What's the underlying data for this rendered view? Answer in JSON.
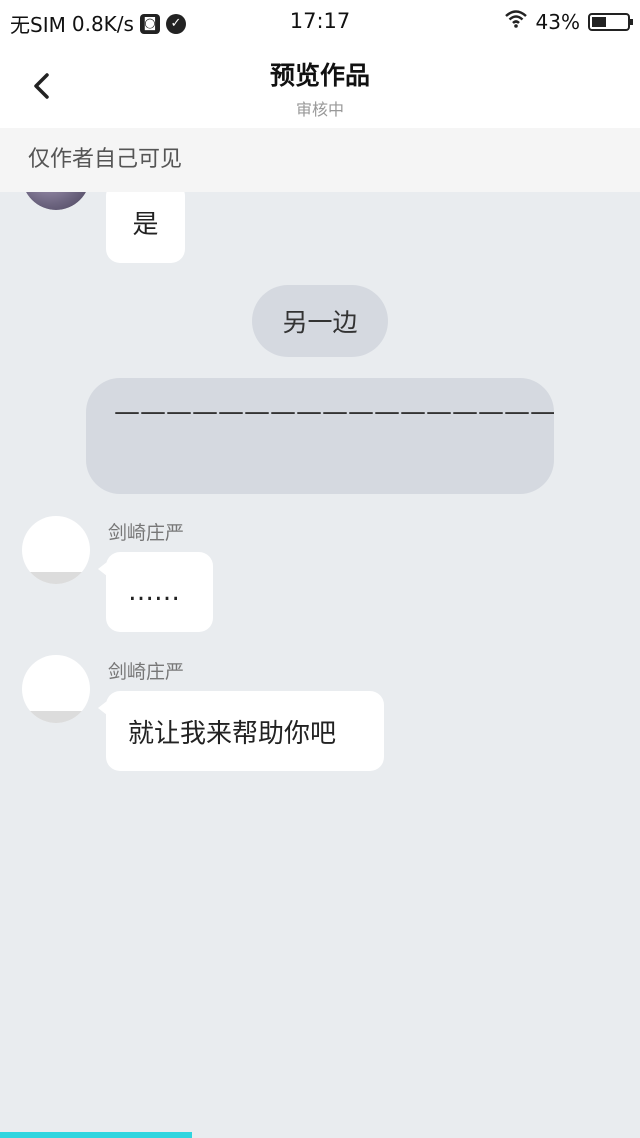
{
  "status_bar": {
    "carrier": "无SIM",
    "speed": "0.8K/s",
    "time": "17:17",
    "battery_percent": "43%",
    "icons": [
      "app-notification-icon",
      "check-circle-icon",
      "wifi-icon",
      "battery-icon"
    ]
  },
  "header": {
    "title": "预览作品",
    "subtitle": "审核中",
    "back_icon": "chevron-left-icon"
  },
  "notice": {
    "text": "仅作者自己可见"
  },
  "messages": [
    {
      "type": "character",
      "text": "是"
    },
    {
      "type": "aside",
      "text": "另一边"
    },
    {
      "type": "aside-box",
      "text": "————————————————————"
    },
    {
      "type": "character",
      "speaker": "剑崎庄严",
      "text": "……"
    },
    {
      "type": "character",
      "speaker": "剑崎庄严",
      "text": "就让我来帮助你吧"
    }
  ],
  "progress": {
    "fraction": 0.3,
    "color": "#2fd5df"
  },
  "colors": {
    "background": "#e9ecef",
    "bubble": "#ffffff",
    "aside": "#d5d9e0"
  }
}
